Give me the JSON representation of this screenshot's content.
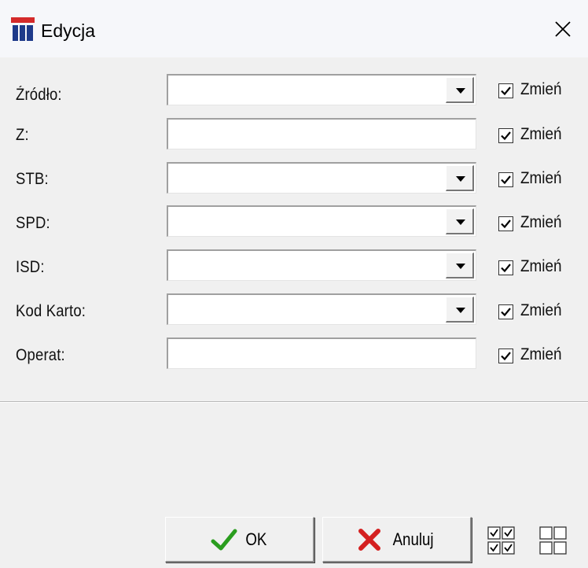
{
  "window": {
    "title": "Edycja",
    "icon": "app-logo-icon",
    "close_icon": "close-icon"
  },
  "fields": [
    {
      "label": "Źródło:",
      "type": "combo",
      "value": "",
      "change_label": "Zmień",
      "checked": true
    },
    {
      "label": "Z:",
      "type": "text",
      "value": "",
      "change_label": "Zmień",
      "checked": true
    },
    {
      "label": "STB:",
      "type": "combo",
      "value": "",
      "change_label": "Zmień",
      "checked": true
    },
    {
      "label": "SPD:",
      "type": "combo",
      "value": "",
      "change_label": "Zmień",
      "checked": true
    },
    {
      "label": "ISD:",
      "type": "combo",
      "value": "",
      "change_label": "Zmień",
      "checked": true
    },
    {
      "label": "Kod Karto:",
      "type": "combo",
      "value": "",
      "change_label": "Zmień",
      "checked": true
    },
    {
      "label": "Operat:",
      "type": "text",
      "value": "",
      "change_label": "Zmień",
      "checked": true
    }
  ],
  "buttons": {
    "ok_label": "OK",
    "cancel_label": "Anuluj",
    "check_all_icon": "check-all-icon",
    "uncheck_all_icon": "uncheck-all-icon"
  },
  "colors": {
    "ok_check": "#2a9d1e",
    "cancel_x": "#d42020",
    "logo_red": "#d42a2a",
    "logo_blue": "#1e3a8a"
  }
}
